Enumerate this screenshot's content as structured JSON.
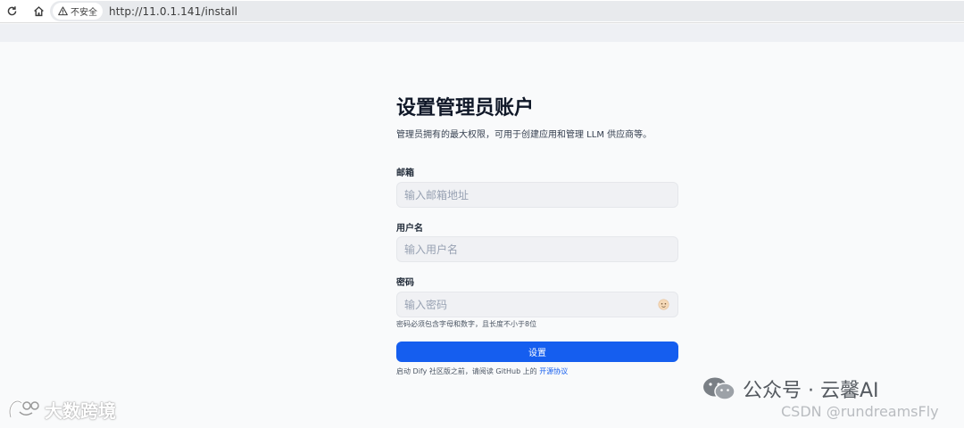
{
  "browser": {
    "security_label": "不安全",
    "url": "http://11.0.1.141/install"
  },
  "form": {
    "title": "设置管理员账户",
    "subtitle": "管理员拥有的最大权限，可用于创建应用和管理 LLM 供应商等。",
    "email": {
      "label": "邮箱",
      "placeholder": "输入邮箱地址",
      "value": ""
    },
    "username": {
      "label": "用户名",
      "placeholder": "输入用户名",
      "value": ""
    },
    "password": {
      "label": "密码",
      "placeholder": "输入密码",
      "value": "",
      "hint": "密码必须包含字母和数字，且长度不小于8位"
    },
    "submit_label": "设置",
    "footer_prefix": "启动 Dify 社区版之前，请阅读 GitHub 上的 ",
    "footer_link": "开源协议"
  },
  "watermarks": {
    "left": "大数跨境",
    "right_main": "公众号 · 云馨AI",
    "right_sub": "CSDN @rundreamsFly"
  },
  "colors": {
    "accent": "#155eef",
    "page_bg": "#f9fafb",
    "input_bg": "#f0f1f4"
  },
  "icons": [
    "reload-icon",
    "home-icon",
    "warning-icon",
    "eye-icon",
    "wechat-icon",
    "brand-logo-icon"
  ]
}
